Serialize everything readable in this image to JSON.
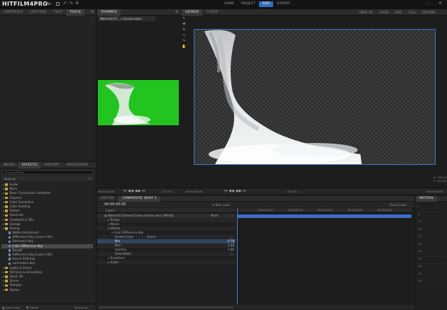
{
  "app": {
    "logo": "HITFILM4PRO",
    "file_menu": "File"
  },
  "topnav": [
    "HOME",
    "PROJECT",
    "EDIT",
    "EXPORT"
  ],
  "topnav_active": "EDIT",
  "left_tabs": [
    "CONTROLS",
    "LIGHTING",
    "TEXT",
    "TRACK"
  ],
  "left_tabs_active": "TRACK",
  "trimmer": {
    "tab": "TRIMMER",
    "clip_name": "Waterfall El... n Screen.wmv",
    "timecode_left": "00:00:00:00",
    "zoom": "(27.1%)",
    "timecode_right": "00:00:05:02"
  },
  "viewer": {
    "tabs": [
      "VIEWER",
      "LAYER"
    ],
    "view_label": "VIEW: 2D",
    "local_label": "LOCAL",
    "rgb_label": "RGB",
    "full_label": "FULL",
    "options_label": "OPTIONS",
    "coords": [
      "X: -909.21",
      "Y: -431.46"
    ],
    "timecode_left": "00:00:00:00",
    "timecode_right": "00:00:05:02",
    "zoom_readout": "(37.1%)",
    "bottom_right": "00:00:05:05"
  },
  "effects": {
    "tabs": [
      "MEDIA",
      "EFFECTS",
      "HISTORY",
      "PROCESSOR"
    ],
    "active_tab": "EFFECTS",
    "search_placeholder": "Search Effects",
    "show_label": "Show All",
    "items": [
      {
        "label": "Audio",
        "depth": 0
      },
      {
        "label": "Blurs",
        "depth": 0
      },
      {
        "label": "Basic Continuous Complete",
        "depth": 0
      },
      {
        "label": "Channel",
        "depth": 0
      },
      {
        "label": "Color Correction",
        "depth": 0
      },
      {
        "label": "Color Grading",
        "depth": 0
      },
      {
        "label": "Distort",
        "depth": 0
      },
      {
        "label": "Generate",
        "depth": 0
      },
      {
        "label": "Gradients & Fills",
        "depth": 0
      },
      {
        "label": "Grunge",
        "depth": 0
      },
      {
        "label": "Keying",
        "depth": 0
      },
      {
        "label": "Matte (Advanced)",
        "depth": 1
      },
      {
        "label": "Difference Key [Layer Info]",
        "depth": 1
      },
      {
        "label": "Demosaic Key",
        "depth": 1
      },
      {
        "label": "Color Difference Key",
        "depth": 1,
        "selected": true
      },
      {
        "label": "Despill",
        "depth": 1
      },
      {
        "label": "Difference Key [Layer Info]",
        "depth": 1
      },
      {
        "label": "Hue & RGB Key",
        "depth": 1
      },
      {
        "label": "Luminance Key",
        "depth": 1
      },
      {
        "label": "Lights & Flares",
        "depth": 0
      },
      {
        "label": "Particles & Simulation",
        "depth": 0
      },
      {
        "label": "Quick 3D",
        "depth": 0
      },
      {
        "label": "Scene",
        "depth": 0
      },
      {
        "label": "Sharpen",
        "depth": 0
      },
      {
        "label": "Stylize",
        "depth": 0
      }
    ],
    "footer_new": "New Folder",
    "footer_delete": "Delete",
    "footer_count": "98 Item(s)"
  },
  "timeline": {
    "tabs": [
      "EDITOR",
      "COMPOSITE SHOT 1"
    ],
    "timecode": "00:00:00:00",
    "new_layer": "New Layer",
    "show_graph": "Show Graph",
    "layers_header": "Layers",
    "ruler": [
      "00:00:01:00",
      "00:00:02:00",
      "00:00:03:00",
      "00:00:04:00",
      "00:00:05:00"
    ],
    "rows": [
      {
        "label": "Waterfall Element Green Screen.wmv [Media]",
        "depth": 0,
        "value": "None",
        "style": "layer"
      },
      {
        "label": "Tracks",
        "depth": 1,
        "value": "",
        "style": "alt"
      },
      {
        "label": "Masks",
        "depth": 1,
        "value": "",
        "style": ""
      },
      {
        "label": "Effects",
        "depth": 1,
        "value": "",
        "style": "alt"
      },
      {
        "label": "Color Difference Key",
        "depth": 2,
        "value": "",
        "style": ""
      },
      {
        "label": "Screen Color",
        "depth": 3,
        "value": "Green",
        "style": "alt"
      },
      {
        "label": "Min",
        "depth": 3,
        "value": "0.78",
        "style": "hl"
      },
      {
        "label": "Max",
        "depth": 3,
        "value": "1.00",
        "style": "alt"
      },
      {
        "label": "Gamma",
        "depth": 3,
        "value": "1.00",
        "style": ""
      },
      {
        "label": "View Matte",
        "depth": 3,
        "value": "",
        "style": "alt"
      },
      {
        "label": "Transform",
        "depth": 1,
        "value": "",
        "style": ""
      },
      {
        "label": "Audio",
        "depth": 1,
        "value": "",
        "style": "alt"
      }
    ]
  },
  "meters": {
    "title": "METERS",
    "labels": [
      "0",
      "-6",
      "-12",
      "-18",
      "-24",
      "-30",
      "-36",
      "-42",
      "-48",
      "-54",
      "-60"
    ]
  },
  "colors": {
    "accent": "#2e6fc1",
    "green_screen": "#22c41f",
    "selection": "#2f4560"
  }
}
